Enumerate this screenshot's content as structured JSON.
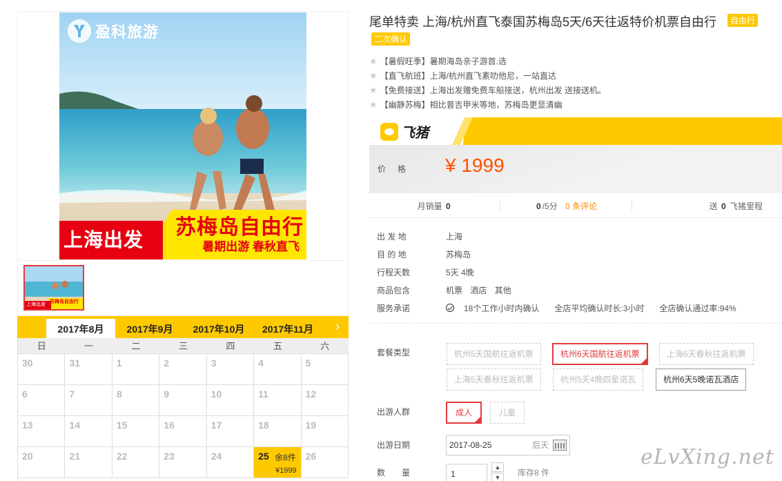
{
  "gallery": {
    "logo_text": "盈科旅游",
    "banner_depart": "上海出发",
    "banner_title": "苏梅岛自由行",
    "banner_sub": "暑期出游  春秋直飞",
    "thumb_depart": "上海出发",
    "thumb_title": "苏梅岛自由行"
  },
  "calendar": {
    "months": [
      "2017年8月",
      "2017年9月",
      "2017年10月",
      "2017年11月"
    ],
    "active_month_index": 0,
    "weekdays": [
      "日",
      "一",
      "二",
      "三",
      "四",
      "五",
      "六"
    ],
    "weeks": [
      [
        "30",
        "31",
        "1",
        "2",
        "3",
        "4",
        "5"
      ],
      [
        "6",
        "7",
        "8",
        "9",
        "10",
        "11",
        "12"
      ],
      [
        "13",
        "14",
        "15",
        "16",
        "17",
        "18",
        "19"
      ],
      [
        "20",
        "21",
        "22",
        "23",
        "24",
        "25",
        "26"
      ]
    ],
    "selected": {
      "day": "25",
      "stock": "余8件",
      "price": "¥1999"
    }
  },
  "product": {
    "title": "尾单特卖 上海/杭州直飞泰国苏梅岛5天/6天往返特价机票自由行",
    "tag_type": "自由行",
    "tag_confirm": "二次确认",
    "features": [
      "【暑假旺季】暑期海岛亲子游首.选",
      "【直飞航班】上海/杭州直飞素叻他尼，一站直达",
      "【免费接送】上海出发赠免费车船接送，杭州出发 送接送机。",
      "【幽静苏梅】相比普吉甲米等地，苏梅岛更显清幽"
    ]
  },
  "price": {
    "brand": "飞猪",
    "label": "价格",
    "value": "¥ 1999"
  },
  "sales": {
    "monthly_label": "月销量",
    "monthly_value": "0",
    "score_value": "0",
    "score_unit": "/5分",
    "reviews": "0 条评论",
    "points_prefix": "送",
    "points_value": "0",
    "points_suffix": "飞猪里程"
  },
  "info": {
    "depart_label": "出 发 地",
    "depart_value": "上海",
    "dest_label": "目 的 地",
    "dest_value": "苏梅岛",
    "days_label": "行程天数",
    "days_value": "5天 4晚",
    "includes_label": "商品包含",
    "includes": [
      "机票",
      "酒店",
      "其他"
    ],
    "promise_label": "服务承诺",
    "promises": [
      "18个工作小时内确认",
      "全店平均确认时长:3小时",
      "全店确认通过率:94%"
    ]
  },
  "options": {
    "package_label": "套餐类型",
    "packages": [
      "杭州5天国航往返机票",
      "杭州6天国航往返机票",
      "上海6天春秋往返机票",
      "上海5天春秋往返机票",
      "杭州5天4晚四星诺瓦",
      "杭州6天5晚诺瓦酒店"
    ],
    "selected_package": "杭州6天国航往返机票",
    "traveler_label": "出游人群",
    "travelers": [
      "成人",
      "儿童"
    ],
    "selected_traveler": "成人",
    "date_label": "出游日期",
    "date_value": "2017-08-25",
    "date_day": "后天",
    "qty_label": "数　　量",
    "qty_value": "1",
    "stock_text": "库存8 件"
  },
  "watermark": "eLvXing.net",
  "colors": {
    "accent_yellow": "#ffc900",
    "price_orange": "#ff5000",
    "select_red": "#e4393c"
  }
}
